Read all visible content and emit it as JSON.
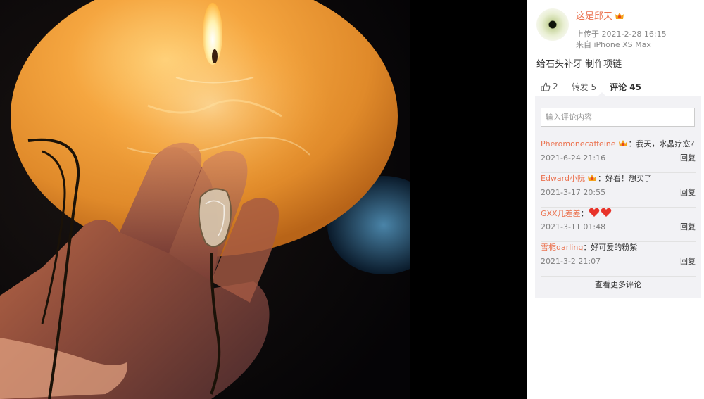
{
  "author": {
    "name": "这是邱天",
    "uploaded": "上传于 2021-2-28 16:15",
    "device": "来自 iPhone XS Max"
  },
  "post": {
    "text": "给石头补牙 制作项链"
  },
  "actions": {
    "like_count": "2",
    "repost_label": "转发 5",
    "comment_label": "评论 45"
  },
  "comment_input": {
    "placeholder": "输入评论内容"
  },
  "comments": [
    {
      "user": "Pheromonecaffeine",
      "has_badge": true,
      "text": "：我天，水晶疗愈?",
      "time": "2021-6-24 21:16",
      "reply": "回复"
    },
    {
      "user": "Edward小阮",
      "has_badge": true,
      "text": "：好看！想买了",
      "time": "2021-3-17 20:55",
      "reply": "回复"
    },
    {
      "user": "GXX几差差",
      "has_badge": false,
      "text": "：",
      "time": "2021-3-11 01:48",
      "reply": "回复"
    },
    {
      "user": "雪栀darling",
      "has_badge": false,
      "text": "：好可爱的粉紫",
      "time": "2021-3-2 21:07",
      "reply": "回复"
    }
  ],
  "more_comments_label": "查看更多评论",
  "colors": {
    "username": "#eb7350",
    "panel_bg": "#ffffff",
    "comments_bg": "#f2f2f5",
    "viewer_bg": "#000000"
  },
  "icons": {
    "like": "thumbs-up-icon",
    "badge": "member-badge-icon",
    "heart": "heart-emoji-icon"
  }
}
